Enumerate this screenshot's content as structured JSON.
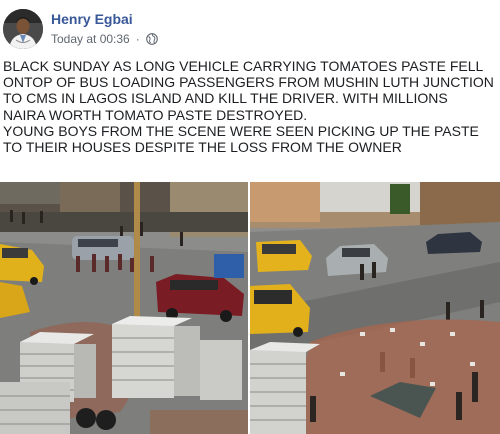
{
  "post": {
    "author": "Henry Egbai",
    "timestamp": "Today at 00:36",
    "dot": "·",
    "privacy_icon": "globe-icon",
    "text_lines": [
      "BLACK SUNDAY AS LONG VEHICLE CARRYING TOMATOES PASTE FELL",
      "ONTOP OF BUS LOADING PASSENGERS FROM MUSHIN LUTH JUNCTION",
      "TO CMS IN LAGOS ISLAND AND KILL THE DRIVER. WITH MILLIONS",
      "NAIRA WORTH TOMATO PASTE DESTROYED.",
      "YOUNG BOYS FROM THE SCENE WERE SEEN PICKING UP THE PASTE",
      "TO THEIR HOUSES DESPITE THE LOSS FROM THE OWNER"
    ]
  },
  "colors": {
    "author_link": "#385898",
    "meta_text": "#606770",
    "body_text": "#1c1e21"
  }
}
